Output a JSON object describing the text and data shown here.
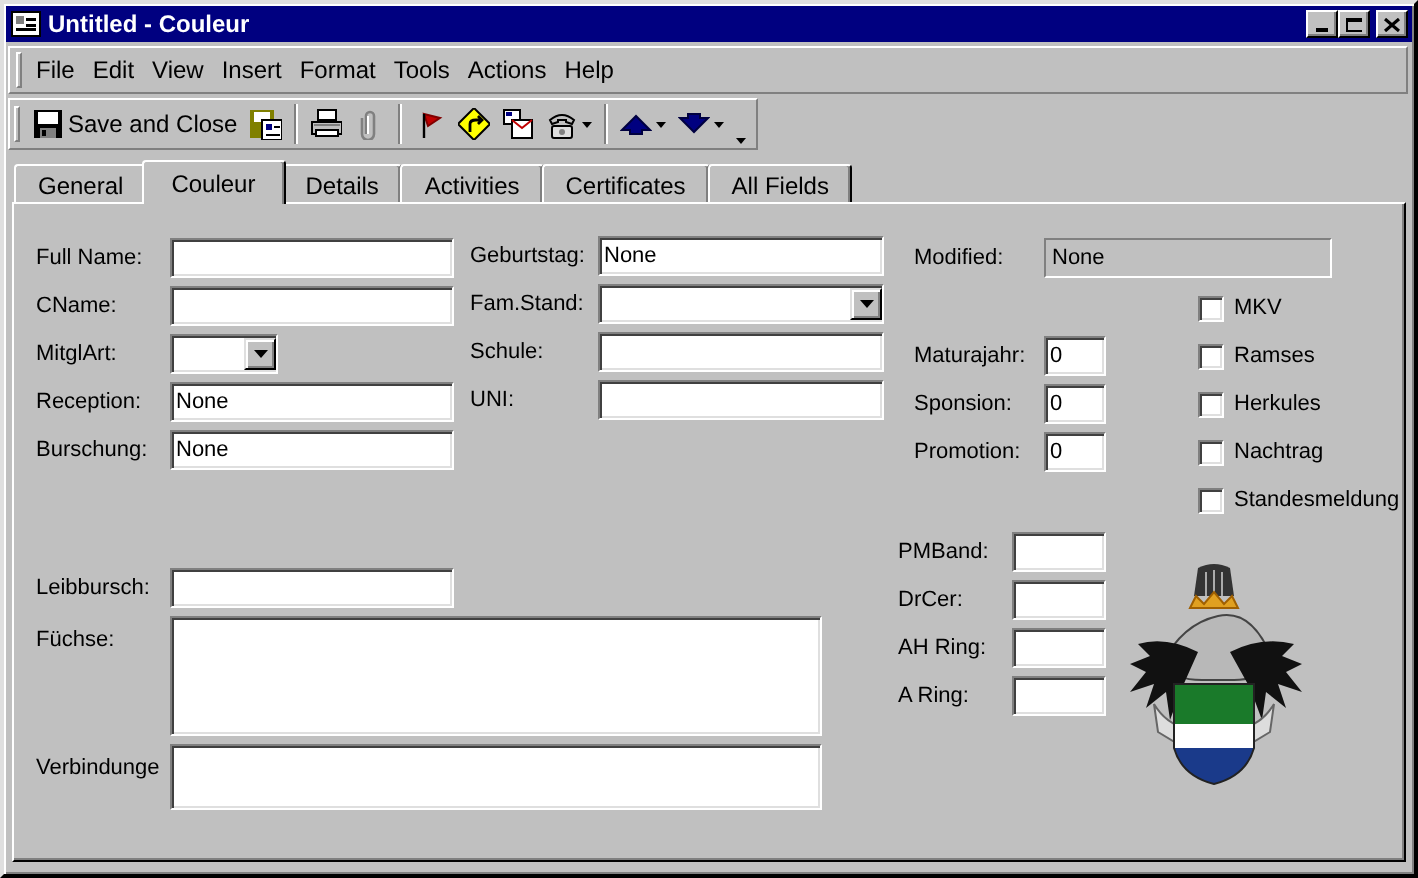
{
  "window": {
    "title": "Untitled - Couleur"
  },
  "menu": [
    "File",
    "Edit",
    "View",
    "Insert",
    "Format",
    "Tools",
    "Actions",
    "Help"
  ],
  "toolbar": [
    [
      {
        "kind": "saveclose",
        "label": "Save and Close",
        "dropdown": false,
        "disabled": false
      },
      {
        "kind": "formsave",
        "dropdown": false,
        "disabled": false
      }
    ],
    [
      {
        "kind": "print",
        "dropdown": false,
        "disabled": false
      },
      {
        "kind": "attach",
        "dropdown": false,
        "disabled": true
      }
    ],
    [
      {
        "kind": "flag",
        "dropdown": false,
        "disabled": false
      },
      {
        "kind": "followup",
        "dropdown": false,
        "disabled": false
      },
      {
        "kind": "message",
        "dropdown": false,
        "disabled": false
      },
      {
        "kind": "phone",
        "dropdown": true,
        "disabled": false
      }
    ],
    [
      {
        "kind": "up",
        "dropdown": true,
        "disabled": false
      },
      {
        "kind": "down",
        "dropdown": true,
        "disabled": false
      }
    ]
  ],
  "tabs": [
    {
      "label": "General",
      "selected": false
    },
    {
      "label": "Couleur",
      "selected": true
    },
    {
      "label": "Details",
      "selected": false
    },
    {
      "label": "Activities",
      "selected": false
    },
    {
      "label": "Certificates",
      "selected": false
    },
    {
      "label": "All Fields",
      "selected": false
    }
  ],
  "form": {
    "left": [
      {
        "label": "Full Name:",
        "kind": "text"
      },
      {
        "label": "CName:",
        "kind": "text"
      },
      {
        "label": "MitglArt:",
        "kind": "picklist"
      },
      {
        "label": "Reception:",
        "kind": "text",
        "value": "None"
      },
      {
        "label": "Burschung:",
        "kind": "text",
        "value": "None"
      }
    ],
    "middle": [
      {
        "label": "Geburtstag:",
        "kind": "text",
        "value": "None"
      },
      {
        "label": "Fam.Stand:",
        "kind": "dropdown"
      },
      {
        "label": "Schule:",
        "kind": "text"
      },
      {
        "label": "UNI:",
        "kind": "text"
      }
    ],
    "lower": [
      {
        "label": "Leibbursch:",
        "kind": "text"
      },
      {
        "label": "Füchse:",
        "kind": "memo"
      },
      {
        "label": "Verbindunge",
        "kind": "shortmemo"
      }
    ],
    "modified": {
      "label": "Modified:",
      "kind": "readonly",
      "value": "None"
    },
    "numbers": [
      {
        "label": "Maturajahr:",
        "kind": "number",
        "value": "0"
      },
      {
        "label": "Sponsion:",
        "kind": "number",
        "value": "0"
      },
      {
        "label": "Promotion:",
        "kind": "number",
        "value": "0"
      }
    ],
    "rings": [
      {
        "label": "PMBand:",
        "kind": "number"
      },
      {
        "label": "DrCer:",
        "kind": "number"
      },
      {
        "label": "AH Ring:",
        "kind": "number"
      },
      {
        "label": "A Ring:",
        "kind": "number"
      }
    ],
    "checkboxes": [
      {
        "label": "MKV",
        "checked": false
      },
      {
        "label": "Ramses",
        "checked": false
      },
      {
        "label": "Herkules",
        "checked": false
      },
      {
        "label": "Nachtrag",
        "checked": false
      },
      {
        "label": "Standesmeldung",
        "checked": false
      }
    ]
  }
}
